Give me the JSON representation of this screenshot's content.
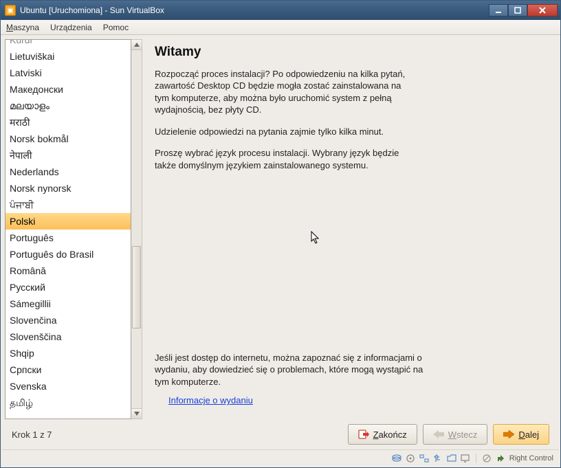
{
  "titlebar": {
    "title": "Ubuntu [Uruchomiona] - Sun VirtualBox"
  },
  "menubar": {
    "machine": "Maszyna",
    "devices": "Urządzenia",
    "help": "Pomoc"
  },
  "languages": {
    "items": [
      "Kurdi",
      "Lietuviškai",
      "Latviski",
      "Македонски",
      "മലയാളം",
      "मराठी",
      "Norsk bokmål",
      "नेपाली",
      "Nederlands",
      "Norsk nynorsk",
      "ਪੰਜਾਬੀ",
      "Polski",
      "Português",
      "Português do Brasil",
      "Română",
      "Русский",
      "Sámegillii",
      "Slovenčina",
      "Slovenščina",
      "Shqip",
      "Српски",
      "Svenska",
      "தமிழ்"
    ],
    "selected_index": 11
  },
  "main": {
    "heading": "Witamy",
    "para1": "Rozpocząć proces instalacji? Po odpowiedzeniu na kilka pytań, zawartość Desktop CD będzie mogła zostać zainstalowana na tym komputerze, aby można było uruchomić system z pełną wydajnością, bez płyty CD.",
    "para2": "Udzielenie odpowiedzi na pytania zajmie tylko kilka minut.",
    "para3": "Proszę wybrać język procesu instalacji. Wybrany język będzie także domyślnym językiem zainstalowanego systemu.",
    "para_release": "Jeśli jest dostęp do internetu, można zapoznać się z informacjami o wydaniu, aby dowiedzieć się o problemach, które mogą wystąpić na tym komputerze.",
    "release_link": "Informacje o wydaniu"
  },
  "footer": {
    "step": "Krok 1 z 7",
    "quit": "Zakończ",
    "back": "Wstecz",
    "next": "Dalej"
  },
  "statusbar": {
    "host_key": "Right Control"
  }
}
